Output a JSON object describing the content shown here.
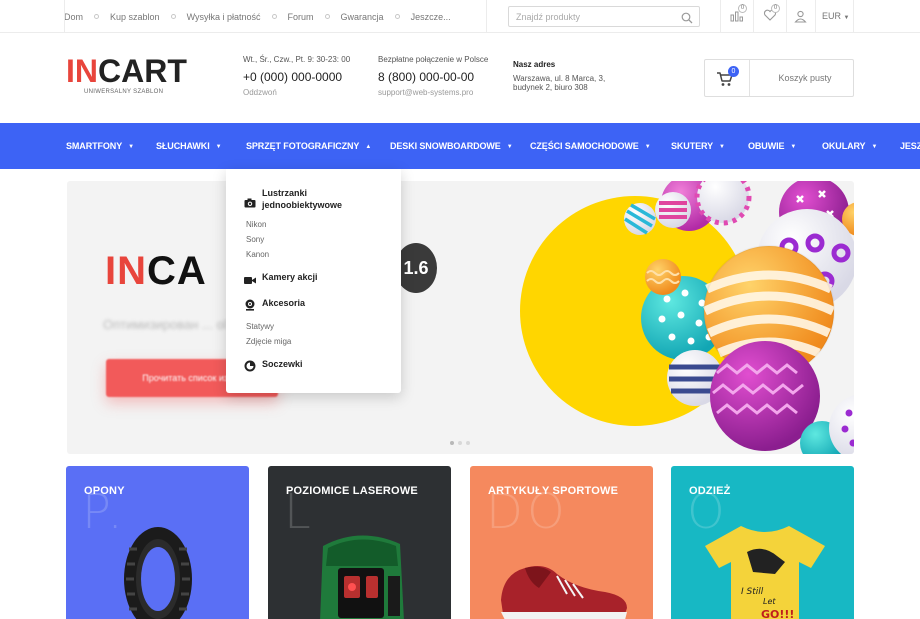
{
  "topbar": {
    "nav": [
      "Dom",
      "Kup szablon",
      "Wysyłka i płatność",
      "Forum",
      "Gwarancja",
      "Jeszcze..."
    ],
    "search_placeholder": "Znajdź produkty",
    "compare_count": "0",
    "wishlist_count": "0",
    "currency": "EUR"
  },
  "header": {
    "logo_in": "IN",
    "logo_cart": "CART",
    "logo_sub": "UNIWERSALNY SZABLON",
    "hours_label": "Wt., Śr., Czw., Pt. 9: 30-23: 00",
    "phone": "+0 (000) 000-0000",
    "callback": "Oddzwoń",
    "free_call_label": "Bezpłatne połączenie w Polsce",
    "free_phone": "8 (800) 000-00-00",
    "email": "support@web-systems.pro",
    "address_title": "Nasz adres",
    "address_line1": "Warszawa, ul. 8 Marca, 3,",
    "address_line2": "budynek 2, biuro 308",
    "cart_count": "0",
    "cart_label": "Koszyk pusty"
  },
  "mainnav": {
    "items": [
      "SMARTFONY",
      "SŁUCHAWKI",
      "SPRZĘT FOTOGRAFICZNY",
      "DESKI SNOWBOARDOWE",
      "CZĘŚCI SAMOCHODOWE",
      "SKUTERY",
      "OBUWIE",
      "OKULARY",
      "JESZCZ"
    ]
  },
  "dropdown": {
    "groups": [
      {
        "title": "Lustrzanki jednoobiektywowe",
        "icon": "camera-icon",
        "items": [
          "Nikon",
          "Sony",
          "Kanon"
        ]
      },
      {
        "title": "Kamery akcji",
        "icon": "video-camera-icon",
        "items": []
      },
      {
        "title": "Akcesoria",
        "icon": "webcam-icon",
        "items": [
          "Statywy",
          "Zdjęcie miga"
        ]
      },
      {
        "title": "Soczewki",
        "icon": "lens-icon",
        "items": []
      }
    ]
  },
  "hero": {
    "title_in": "IN",
    "title_ca": "CA",
    "version": "1.6",
    "subtitle": "Оптимизирован ... ol",
    "button": "Прочитать список изм...",
    "slides": 3,
    "active_slide": 1
  },
  "categories": [
    {
      "title": "OPONY",
      "watermark": "P.",
      "color": "#5a6ff5"
    },
    {
      "title": "POZIOMICE LASEROWE",
      "watermark": "L",
      "color": "#2d3033"
    },
    {
      "title": "ARTYKUŁY SPORTOWE",
      "watermark": "DO",
      "color": "#f5895e"
    },
    {
      "title": "ODZIEŻ",
      "watermark": "O",
      "color": "#17b8c4"
    }
  ],
  "colors": {
    "accent": "#3d63f5",
    "brand_red": "#e8453c"
  }
}
